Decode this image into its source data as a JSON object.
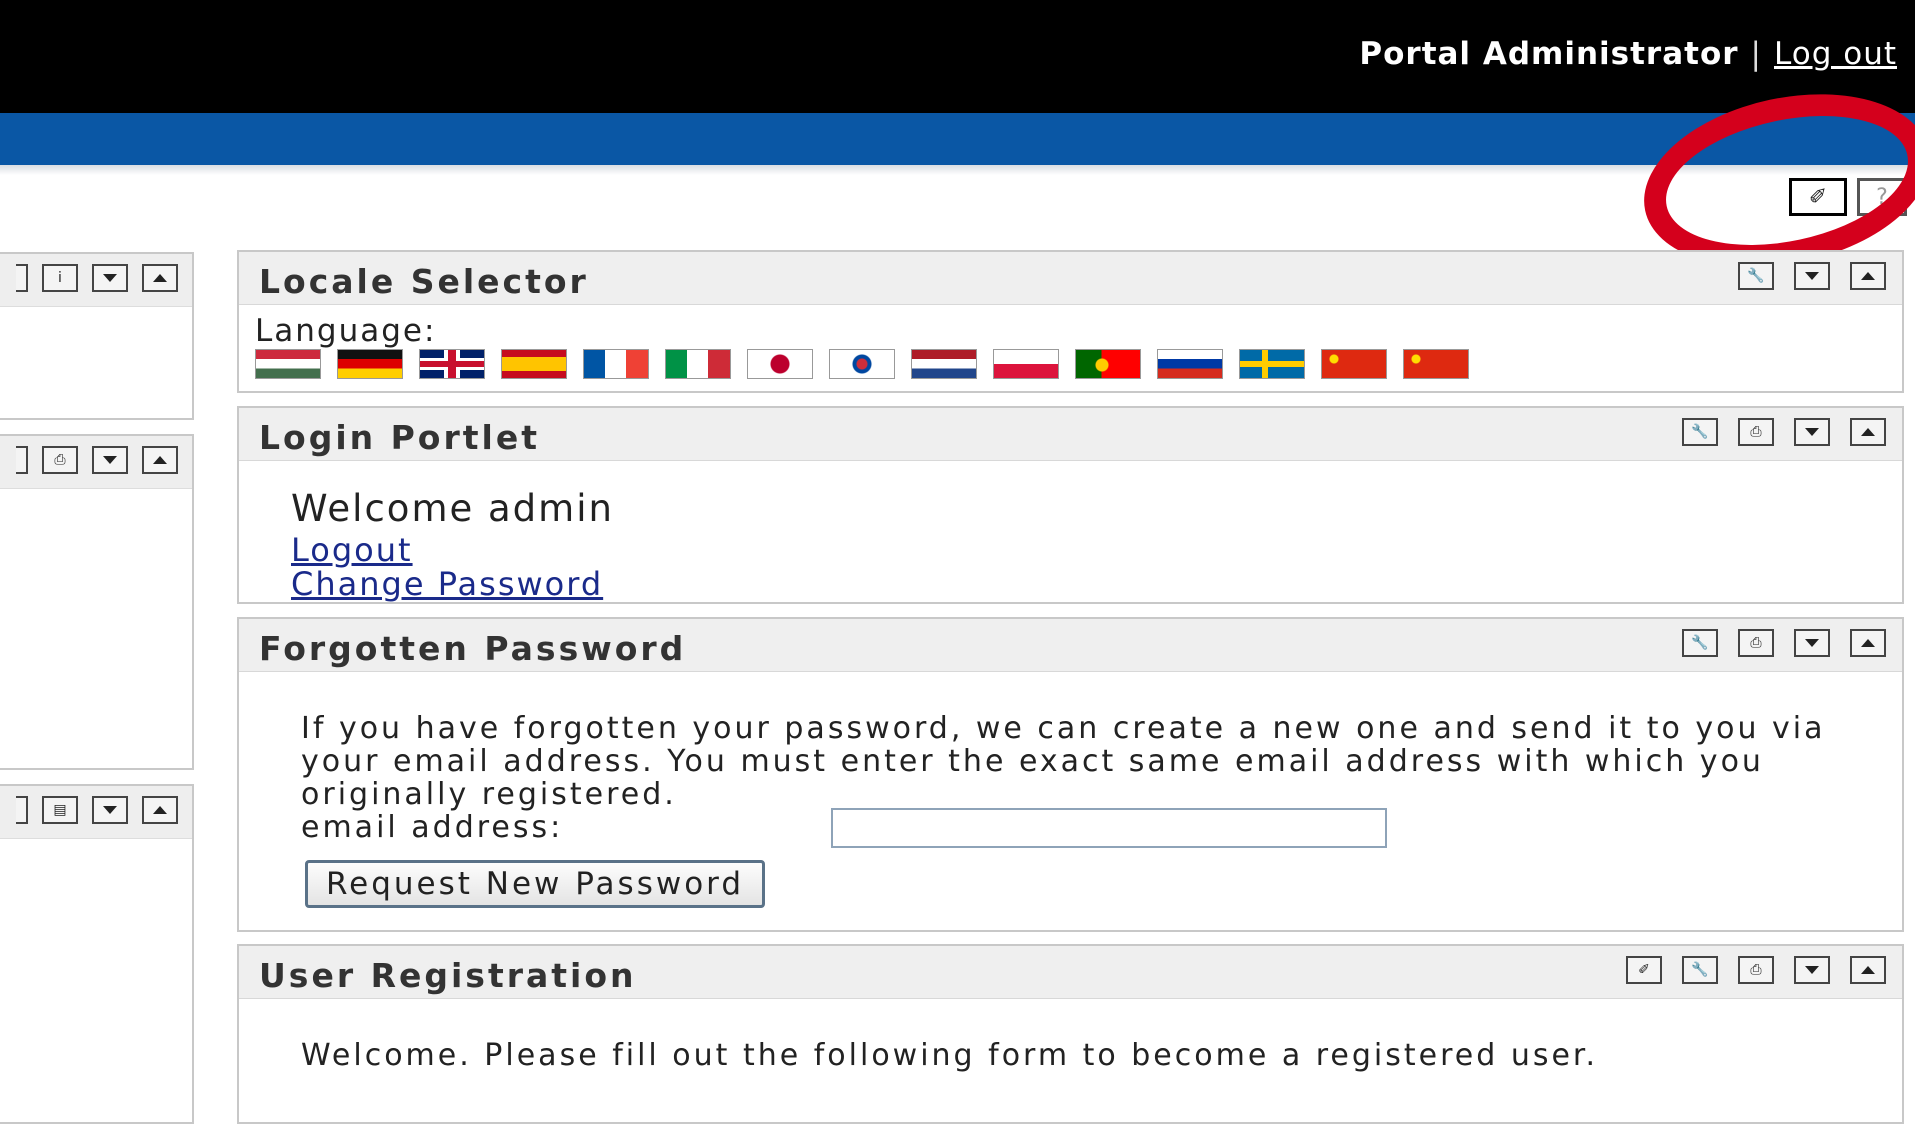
{
  "header": {
    "user_name": "Portal Administrator",
    "separator": "|",
    "logout_label": "Log out"
  },
  "page_tools": [
    {
      "name": "edit-mode-icon",
      "glyph": "✐"
    },
    {
      "name": "help-icon",
      "glyph": "?"
    }
  ],
  "left_portlets": [
    {
      "icons": [
        "info-icon",
        "minimize-icon",
        "maximize-icon"
      ],
      "glyph": "i"
    },
    {
      "icons": [
        "print-icon",
        "minimize-icon",
        "maximize-icon"
      ],
      "glyph": "⎙"
    },
    {
      "icons": [
        "document-icon",
        "minimize-icon",
        "maximize-icon"
      ],
      "glyph": "▤"
    }
  ],
  "locale_selector": {
    "title": "Locale Selector",
    "language_label": "Language:",
    "flags": [
      {
        "name": "hungarian",
        "colors": [
          "#cd2a3e",
          "#ffffff",
          "#436f4d"
        ]
      },
      {
        "name": "german",
        "colors": [
          "#111111",
          "#dd0000",
          "#ffce00"
        ]
      },
      {
        "name": "english",
        "colors": [
          "#012169",
          "#ffffff",
          "#c8102e"
        ]
      },
      {
        "name": "spanish",
        "colors": [
          "#c60b1e",
          "#ffc400",
          "#c60b1e"
        ]
      },
      {
        "name": "french",
        "colors": [
          "#0055a4",
          "#ffffff",
          "#ef4135"
        ]
      },
      {
        "name": "italian",
        "colors": [
          "#009246",
          "#ffffff",
          "#ce2b37"
        ]
      },
      {
        "name": "japanese",
        "colors": [
          "#ffffff",
          "#bc002d"
        ]
      },
      {
        "name": "korean",
        "colors": [
          "#ffffff",
          "#cd2e3a",
          "#0047a0"
        ]
      },
      {
        "name": "dutch",
        "colors": [
          "#ae1c28",
          "#ffffff",
          "#21468b"
        ]
      },
      {
        "name": "polish",
        "colors": [
          "#ffffff",
          "#dc143c"
        ]
      },
      {
        "name": "portuguese",
        "colors": [
          "#006600",
          "#ff0000",
          "#ffcc00"
        ]
      },
      {
        "name": "russian",
        "colors": [
          "#ffffff",
          "#0039a6",
          "#d52b1e"
        ]
      },
      {
        "name": "swedish",
        "colors": [
          "#006aa7",
          "#fecc00"
        ]
      },
      {
        "name": "chinese-simplified",
        "colors": [
          "#de2910",
          "#ffde00"
        ]
      },
      {
        "name": "chinese-traditional",
        "colors": [
          "#de2910",
          "#ffde00"
        ]
      }
    ]
  },
  "login_portlet": {
    "title": "Login Portlet",
    "welcome": "Welcome admin",
    "logout_link": "Logout",
    "change_password_link": "Change Password"
  },
  "forgotten_password": {
    "title": "Forgotten Password",
    "description": "If you have forgotten your password, we can create a new one and send it to you via your email address. You must enter the exact same email address with which you originally registered.",
    "email_label": "email address:",
    "email_value": "",
    "button_label": "Request New Password"
  },
  "user_registration": {
    "title": "User Registration",
    "description": "Welcome. Please fill out the following form to become a registered user."
  },
  "colors": {
    "top_bar": "#000000",
    "blue_bar": "#0a57a5",
    "annotation_circle": "#d4001c",
    "link": "#1a2a8a"
  }
}
